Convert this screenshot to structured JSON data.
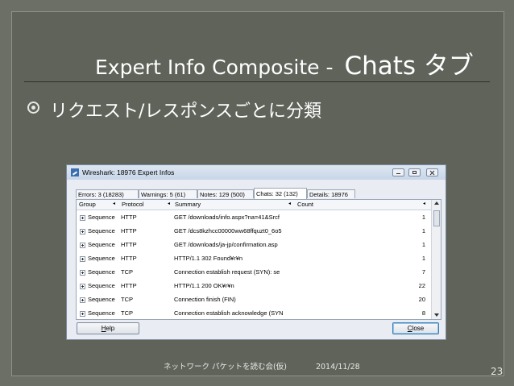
{
  "slide": {
    "title_part1": "Expert Info Composite - ",
    "title_part2": "Chats タブ",
    "bullet": "リクエスト/レスポンスごとに分類",
    "footer_left": "ネットワーク パケットを読む会(仮)",
    "footer_date": "2014/11/28",
    "page_number": "23"
  },
  "window": {
    "title": "Wireshark: 18976 Expert Infos",
    "tabs": [
      {
        "label": "Errors: 3 (18283)"
      },
      {
        "label": "Warnings: 5 (61)"
      },
      {
        "label": "Notes: 129 (500)"
      },
      {
        "label": "Chats: 32 (132)"
      },
      {
        "label": "Details: 18976"
      }
    ],
    "active_tab": "Chats: 32 (132)",
    "columns": {
      "group": "Group",
      "protocol": "Protocol",
      "summary": "Summary",
      "count": "Count"
    },
    "rows": [
      {
        "group": "Sequence",
        "protocol": "HTTP",
        "summary": "GET /downloads/info.aspx?na=41&Srcf",
        "count": "1"
      },
      {
        "group": "Sequence",
        "protocol": "HTTP",
        "summary": "GET /dcs8kzhcc00000ww68ffquzt0_6o5",
        "count": "1"
      },
      {
        "group": "Sequence",
        "protocol": "HTTP",
        "summary": "GET /downloads/ja-jp/confirmation.asp",
        "count": "1"
      },
      {
        "group": "Sequence",
        "protocol": "HTTP",
        "summary": "HTTP/1.1 302 Found¥r¥n",
        "count": "1"
      },
      {
        "group": "Sequence",
        "protocol": "TCP",
        "summary": "Connection establish request (SYN): se",
        "count": "7"
      },
      {
        "group": "Sequence",
        "protocol": "HTTP",
        "summary": "HTTP/1.1 200 OK¥r¥n",
        "count": "22"
      },
      {
        "group": "Sequence",
        "protocol": "TCP",
        "summary": "Connection finish (FIN)",
        "count": "20"
      },
      {
        "group": "Sequence",
        "protocol": "TCP",
        "summary": "Connection establish acknowledge (SYN",
        "count": "8"
      }
    ],
    "help_button": {
      "mnemonic": "H",
      "rest": "elp"
    },
    "close_button": {
      "mnemonic": "C",
      "rest": "lose"
    }
  }
}
